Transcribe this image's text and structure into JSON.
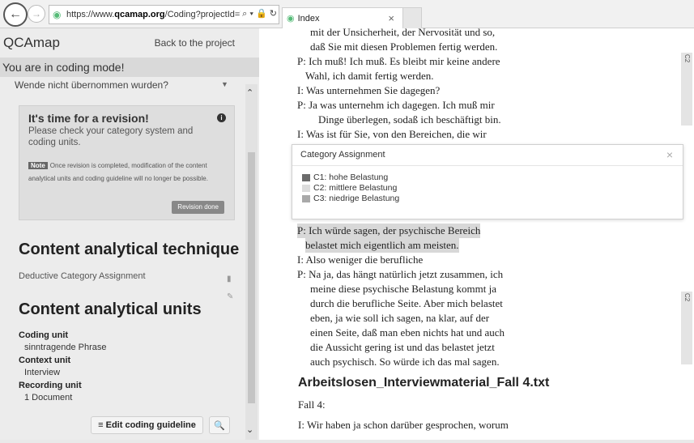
{
  "browser": {
    "url_prefix": "https://www.",
    "url_domain": "qcamap.org",
    "url_path": "/Coding?projectId=7&qu",
    "addr_tools": "⌕ ▾ 🔒 ↻",
    "tab_title": "Index",
    "tab_close": "×"
  },
  "left": {
    "app_title": "QCAmap",
    "back_link": "Back to the project",
    "mode_banner": "You are in coding mode!",
    "truncated_item": "Wende nicht übernommen wurden?",
    "revision": {
      "title": "It's time for a revision!",
      "text": "Please check your category system and coding units.",
      "note_badge": "Note",
      "note_text": "Once revision is completed, modification of the content analytical units and coding guideline will no longer be possible.",
      "done_button": "Revision done"
    },
    "technique_heading": "Content analytical technique",
    "technique_item": "Deductive Category Assignment",
    "units_heading": "Content analytical units",
    "coding_unit_label": "Coding unit",
    "coding_unit_value": "sinntragende Phrase",
    "context_unit_label": "Context unit",
    "context_unit_value": "Interview",
    "recording_unit_label": "Recording unit",
    "recording_unit_value": "1 Document",
    "edit_guideline": "≡ Edit coding guideline",
    "search_icon_glyph": "🔍"
  },
  "transcript": {
    "lines_top": [
      "mit der Unsicherheit, der Nervosität und so,",
      "daß Sie mit diesen Problemen fertig werden.",
      "P:  Ich muß! Ich muß. Es bleibt mir keine andere",
      "Wahl, ich damit fertig werden.",
      "I:  Was unternehmen Sie dagegen?",
      "P:  Ja was unternehm ich dagegen. Ich muß mir",
      "Dinge überlegen, sodaß ich beschäftigt bin.",
      "I:  Was ist für Sie, von den Bereichen, die wir"
    ],
    "hl_line_1": "P:  Ich  würde  sagen,  der  psychische  Bereich",
    "hl_line_2": "belastet mich eigentlich am meisten.",
    "lines_bottom": [
      "I:  Also weniger die berufliche",
      "P:  Na ja, das hängt natürlich jetzt zusammen, ich",
      "meine diese psychische Belastung kommt ja",
      "durch die berufliche Seite. Aber mich belastet",
      "eben, ja wie soll ich sagen, na klar, auf  der",
      "einen Seite, daß man eben nichts hat und  auch",
      "die Aussicht gering ist und das belastet jetzt",
      "auch psychisch. So würde ich das mal sagen."
    ],
    "file_heading": "Arbeitslosen_Interviewmaterial_Fall 4.txt",
    "case_label": "Fall 4:",
    "last_line": "I:  Wir  haben ja schon darüber gesprochen,  worum"
  },
  "markers": {
    "label": "C2"
  },
  "dialog": {
    "title": "Category Assignment",
    "close": "×",
    "categories": [
      {
        "label": "C1: hohe Belastung",
        "color": "#6b6b6b"
      },
      {
        "label": "C2: mittlere Belastung",
        "color": "#dcdcdc"
      },
      {
        "label": "C3: niedrige Belastung",
        "color": "#a9a9a9"
      }
    ]
  }
}
